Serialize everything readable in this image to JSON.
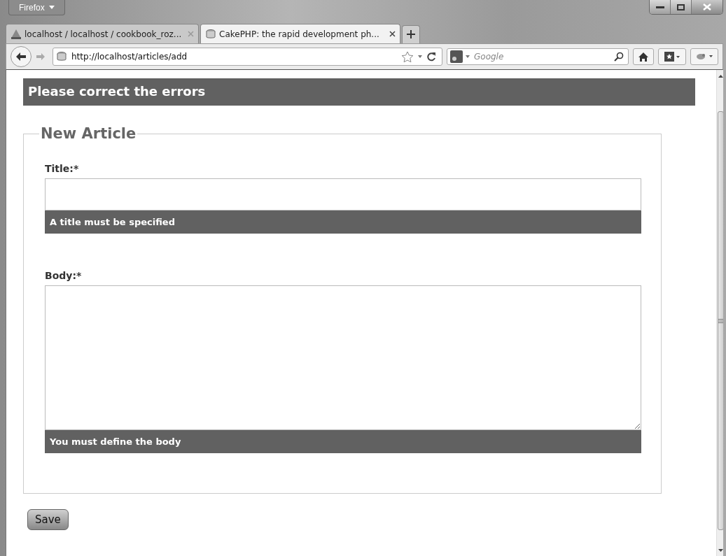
{
  "window": {
    "menu_button": "Firefox"
  },
  "tabs": [
    {
      "title": "localhost / localhost / cookbook_roz...",
      "selected": false
    },
    {
      "title": "CakePHP: the rapid development ph...",
      "selected": true
    }
  ],
  "address": {
    "url": "http://localhost/articles/add"
  },
  "search": {
    "placeholder": "Google"
  },
  "page": {
    "error_banner": "Please correct the errors",
    "legend": "New Article",
    "fields": [
      {
        "kind": "input",
        "label": "Title:*",
        "error": "A title must be specified"
      },
      {
        "kind": "textarea",
        "label": "Body:*",
        "error": "You must define the body"
      }
    ],
    "save_button": "Save"
  }
}
